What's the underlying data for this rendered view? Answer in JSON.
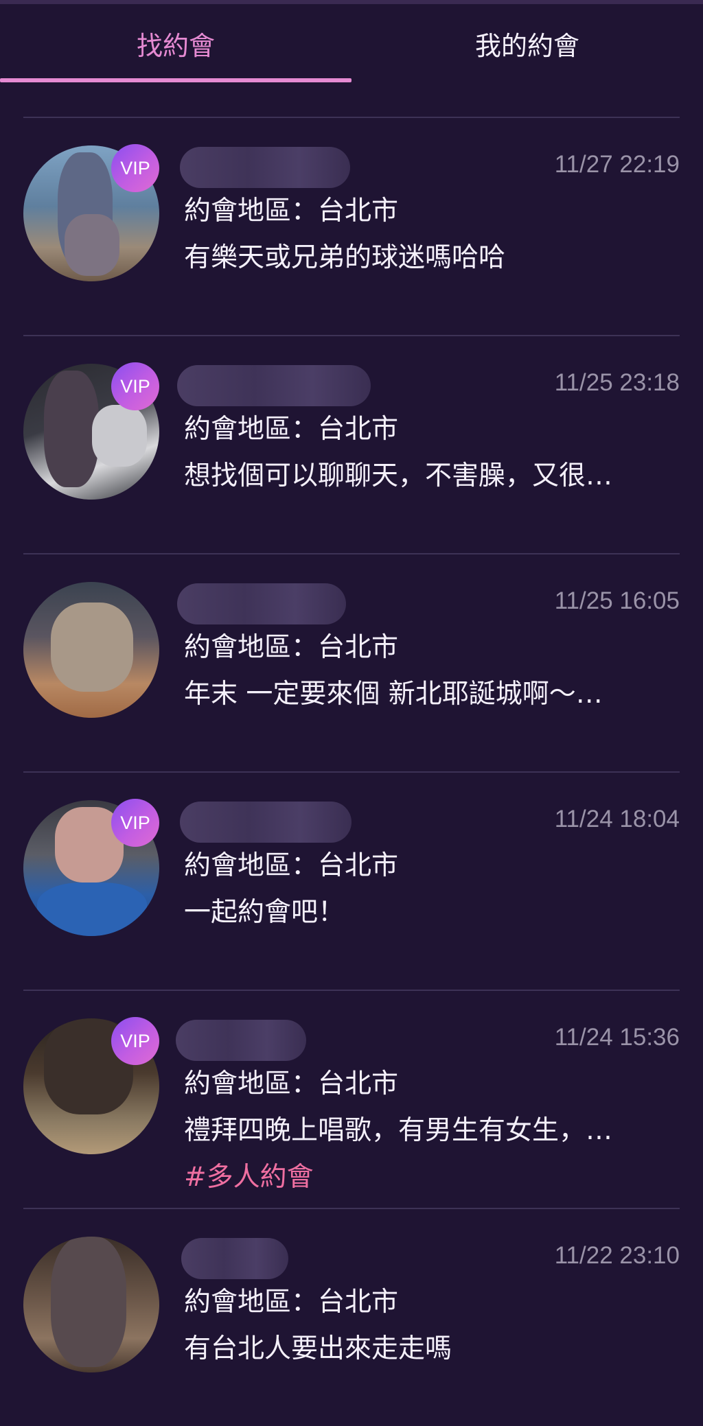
{
  "tabs": [
    {
      "label": "找約會",
      "active": true
    },
    {
      "label": "我的約會",
      "active": false
    }
  ],
  "colors": {
    "background": "#1f1433",
    "accent": "#e58ad2",
    "tag": "#ef6fa1",
    "muted": "#9a93a8"
  },
  "posts": [
    {
      "vip": "VIP",
      "time": "11/27 22:19",
      "region": "約會地區：台北市",
      "desc": "有樂天或兄弟的球迷嗎哈哈",
      "tag": ""
    },
    {
      "vip": "VIP",
      "time": "11/25 23:18",
      "region": "約會地區：台北市",
      "desc": "想找個可以聊聊天，不害臊，又很…",
      "tag": ""
    },
    {
      "vip": "",
      "time": "11/25 16:05",
      "region": "約會地區：台北市",
      "desc": "年末 一定要來個 新北耶誕城啊～…",
      "tag": ""
    },
    {
      "vip": "VIP",
      "time": "11/24 18:04",
      "region": "約會地區：台北市",
      "desc": "一起約會吧！",
      "tag": ""
    },
    {
      "vip": "VIP",
      "time": "11/24 15:36",
      "region": "約會地區：台北市",
      "desc": "禮拜四晚上唱歌，有男生有女生，…",
      "tag": "#多人約會"
    },
    {
      "vip": "",
      "time": "11/22 23:10",
      "region": "約會地區：台北市",
      "desc": "有台北人要出來走走嗎",
      "tag": ""
    }
  ]
}
